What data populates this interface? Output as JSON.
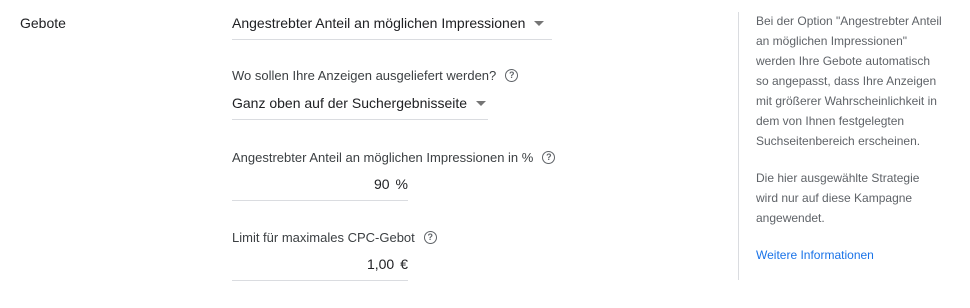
{
  "section_label": "Gebote",
  "bidding": {
    "strategy_value": "Angestrebter Anteil an möglichen Impressionen"
  },
  "placement": {
    "question": "Wo sollen Ihre Anzeigen ausgeliefert werden?",
    "value": "Ganz oben auf der Suchergebnisseite"
  },
  "impression_share": {
    "label": "Angestrebter Anteil an möglichen Impressionen in %",
    "value": "90",
    "unit": "%"
  },
  "max_cpc": {
    "label": "Limit für maximales CPC-Gebot",
    "value": "1,00",
    "unit": "€"
  },
  "sidebar_info": {
    "paragraph1_lines": [
      "Bei der Option \"Angestrebter Anteil",
      "an möglichen Impressionen\"",
      "werden Ihre Gebote automatisch",
      "so angepasst, dass Ihre Anzeigen",
      "mit größerer Wahrscheinlichkeit in",
      "dem von Ihnen festgelegten",
      "Suchseitenbereich erscheinen."
    ],
    "paragraph2_lines": [
      "Die hier ausgewählte Strategie",
      "wird nur auf diese Kampagne",
      "angewendet."
    ],
    "link": "Weitere Informationen"
  },
  "icons": {
    "help": "help-circle-icon",
    "dropdown": "caret-down-icon"
  },
  "colors": {
    "text": "#202124",
    "secondary_text": "#5f6368",
    "link": "#1a73e8",
    "divider": "#dadce0"
  }
}
